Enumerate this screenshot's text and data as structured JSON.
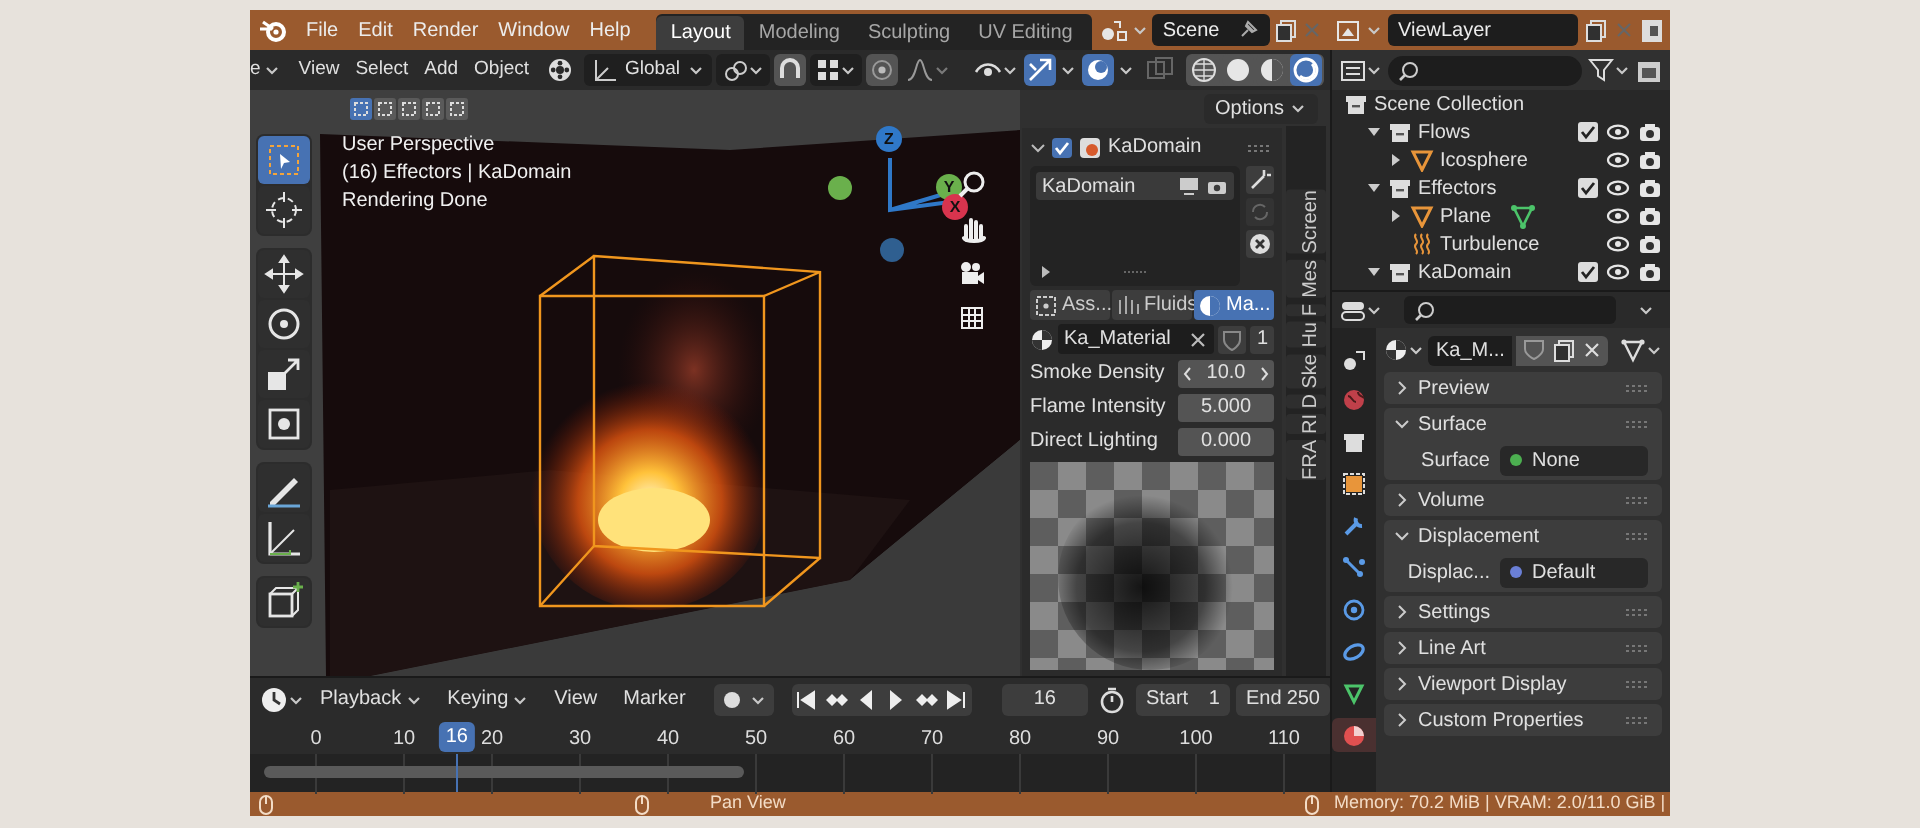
{
  "topbar": {
    "menus": [
      "File",
      "Edit",
      "Render",
      "Window",
      "Help"
    ],
    "workspaces": [
      {
        "label": "Layout",
        "selected": true
      },
      {
        "label": "Modeling",
        "selected": false
      },
      {
        "label": "Sculpting",
        "selected": false
      },
      {
        "label": "UV Editing",
        "selected": false
      }
    ],
    "scene": "Scene",
    "view_layer": "ViewLayer"
  },
  "viewport": {
    "mode": "e",
    "menus": [
      "View",
      "Select",
      "Add",
      "Object"
    ],
    "orientation": "Global",
    "options": "Options",
    "select_modes": [
      {
        "selected": true
      },
      {
        "selected": false
      },
      {
        "selected": false
      },
      {
        "selected": false
      },
      {
        "selected": false
      }
    ],
    "shading_modes": [
      {
        "kind": "wireframe",
        "selected": false
      },
      {
        "kind": "solid",
        "selected": false
      },
      {
        "kind": "material",
        "selected": false
      },
      {
        "kind": "rendered",
        "selected": true
      }
    ],
    "overlay_lines": [
      "User Perspective",
      "(16) Effectors | KaDomain",
      "Rendering Done"
    ],
    "gizmo_axes": [
      "Z",
      "Y",
      "X"
    ],
    "tool_groups": [
      [
        {
          "kind": "select",
          "selected": true
        },
        {
          "kind": "cursor",
          "selected": false
        }
      ],
      [
        {
          "kind": "move",
          "selected": false
        },
        {
          "kind": "rotate",
          "selected": false
        },
        {
          "kind": "scale",
          "selected": false
        },
        {
          "kind": "transform",
          "selected": false
        }
      ],
      [
        {
          "kind": "annotate",
          "selected": false
        },
        {
          "kind": "measure",
          "selected": false
        }
      ],
      [
        {
          "kind": "add_cube",
          "selected": false
        }
      ]
    ]
  },
  "sidebar": {
    "object": "KaDomain",
    "enabled": true,
    "list_item": "KaDomain",
    "tabs": [
      {
        "label": "Ass...",
        "selected": false
      },
      {
        "label": "Fluids",
        "selected": false
      },
      {
        "label": "Ma...",
        "selected": true
      }
    ],
    "material": "Ka_Material",
    "users": "1",
    "fields": [
      {
        "label": "Smoke Density",
        "value": "10.0",
        "kind": "stepper"
      },
      {
        "label": "Flame Intensity",
        "value": "5.000",
        "kind": "number"
      },
      {
        "label": "Direct Lighting",
        "value": "0.000",
        "kind": "number"
      }
    ],
    "vertical_tabs": [
      "Screen",
      "Mes",
      "F",
      "Hu",
      "Ske",
      "D",
      "RI",
      "FRA"
    ]
  },
  "timeline": {
    "menus": [
      "Playback",
      "Keying",
      "View",
      "Marker"
    ],
    "auto_keying": false,
    "current_frame": "16",
    "start_label": "Start",
    "start": "1",
    "end_label": "End",
    "end": "250",
    "ruler": [
      "0",
      "10",
      "20",
      "30",
      "40",
      "50",
      "60",
      "70",
      "80",
      "90",
      "100",
      "110"
    ],
    "playhead": "16"
  },
  "outliner": {
    "tree": [
      {
        "label": "Scene Collection",
        "kind": "collection",
        "children": [
          {
            "label": "Flows",
            "kind": "collection",
            "expanded": true,
            "checked": true,
            "children": [
              {
                "label": "Icosphere",
                "kind": "mesh",
                "expanded": false
              }
            ]
          },
          {
            "label": "Effectors",
            "kind": "collection",
            "expanded": true,
            "checked": true,
            "children": [
              {
                "label": "Plane",
                "kind": "mesh",
                "expanded": false,
                "has_vertex_group": true
              },
              {
                "label": "Turbulence",
                "kind": "force"
              }
            ]
          },
          {
            "label": "KaDomain",
            "kind": "collection",
            "expanded": true,
            "checked": true
          }
        ]
      }
    ]
  },
  "properties": {
    "tabs": [
      {
        "kind": "scene",
        "selected": false
      },
      {
        "kind": "world",
        "selected": false
      },
      {
        "kind": "collection",
        "selected": false
      },
      {
        "kind": "object",
        "selected": false
      },
      {
        "kind": "modifier",
        "selected": false
      },
      {
        "kind": "particles",
        "selected": false
      },
      {
        "kind": "physics",
        "selected": false
      },
      {
        "kind": "constraints",
        "selected": false
      },
      {
        "kind": "data",
        "selected": false
      },
      {
        "kind": "material",
        "selected": true
      }
    ],
    "material": "Ka_M...",
    "panels": [
      {
        "title": "Preview",
        "expanded": false
      },
      {
        "title": "Surface",
        "expanded": true,
        "rows": [
          {
            "label": "Surface",
            "value": "None",
            "color": "#4caf50"
          }
        ]
      },
      {
        "title": "Volume",
        "expanded": false
      },
      {
        "title": "Displacement",
        "expanded": true,
        "rows": [
          {
            "label": "Displac...",
            "value": "Default",
            "color": "#6a7fd6"
          }
        ]
      },
      {
        "title": "Settings",
        "expanded": false
      },
      {
        "title": "Line Art",
        "expanded": false
      },
      {
        "title": "Viewport Display",
        "expanded": false
      },
      {
        "title": "Custom Properties",
        "expanded": false
      }
    ]
  },
  "status_bar": {
    "hint": "Pan View",
    "memory": "Memory: 70.2 MiB | VRAM: 2.0/11.0 GiB |"
  }
}
